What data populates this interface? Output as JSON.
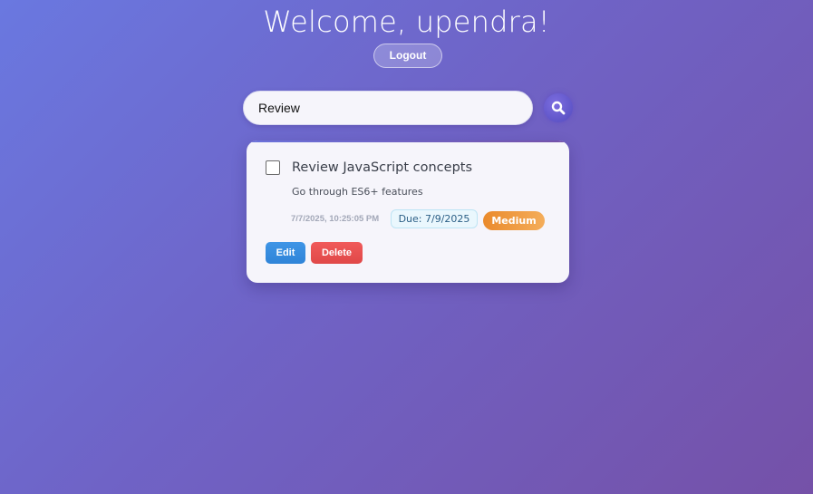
{
  "header": {
    "welcome_text": "Welcome, upendra!",
    "logout_label": "Logout"
  },
  "search": {
    "value": "Review",
    "icon": "search-icon"
  },
  "tasks": [
    {
      "title": "Review JavaScript concepts",
      "description": "Go through ES6+ features",
      "created": "7/7/2025, 10:25:05 PM",
      "due": "Due: 7/9/2025",
      "priority": "Medium",
      "completed": false,
      "edit_label": "Edit",
      "delete_label": "Delete"
    }
  ],
  "colors": {
    "background_start": "#6a78e0",
    "background_end": "#7551a8",
    "edit": "#3a8fe0",
    "delete": "#e85050",
    "priority_medium": "#ee9a40",
    "due_text": "#2c5f86"
  }
}
